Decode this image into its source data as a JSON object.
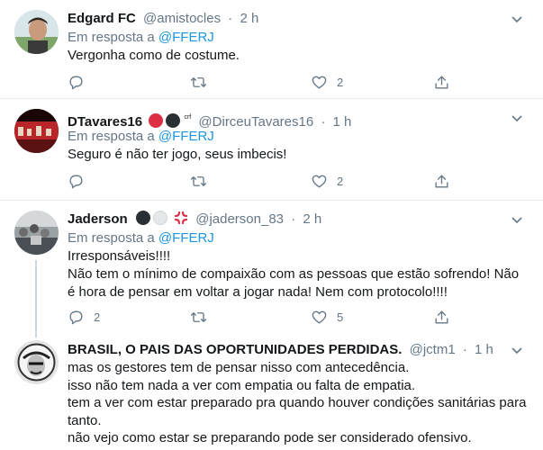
{
  "tweets": [
    {
      "name": "Edgard FC",
      "handle": "@amistocles",
      "dot": "·",
      "time": "2 h",
      "reply_prefix": "Em resposta a",
      "reply_to": "@FFERJ",
      "text": "Vergonha como de costume.",
      "counts": {
        "reply": "",
        "retweet": "",
        "like": "2"
      }
    },
    {
      "name": "DTavares16",
      "badge_text": "crf",
      "handle": "@DirceuTavares16",
      "dot": "·",
      "time": "1 h",
      "reply_prefix": "Em resposta a",
      "reply_to": "@FFERJ",
      "text": "Seguro é não ter jogo, seus imbecis!",
      "counts": {
        "reply": "",
        "retweet": "",
        "like": "2"
      }
    },
    {
      "name": "Jaderson",
      "handle": "@jaderson_83",
      "dot": "·",
      "time": "2 h",
      "reply_prefix": "Em resposta a",
      "reply_to": "@FFERJ",
      "text_line1": "Irresponsáveis!!!!",
      "text_line2": "Não tem o mínimo de compaixão com as pessoas que estão sofrendo! Não",
      "text_line3": "é hora de pensar em voltar a jogar nada! Nem com protocolo!!!!",
      "counts": {
        "reply": "2",
        "retweet": "",
        "like": "5"
      }
    },
    {
      "name": "BRASIL, O PAIS DAS OPORTUNIDADES PERDIDAS.",
      "handle": "@jctm1",
      "dot": "·",
      "time": "1 h",
      "text_line1": "mas os gestores tem de pensar nisso com antecedência.",
      "text_line2": "isso não tem nada a ver com empatia ou falta de empatia.",
      "text_line3": "tem a ver com estar preparado pra quando houver condições sanitárias para",
      "text_line4": "tanto.",
      "text_line5": "não vejo como estar se preparando pode ser considerado ofensivo."
    }
  ],
  "icons": {
    "reply": "reply-icon",
    "retweet": "retweet-icon",
    "like": "heart-icon",
    "share": "share-icon",
    "caret": "chevron-down-icon"
  },
  "colors": {
    "text": "#14171a",
    "secondary": "#657786",
    "link": "#1b95e0",
    "divider": "#e6ecf0"
  }
}
